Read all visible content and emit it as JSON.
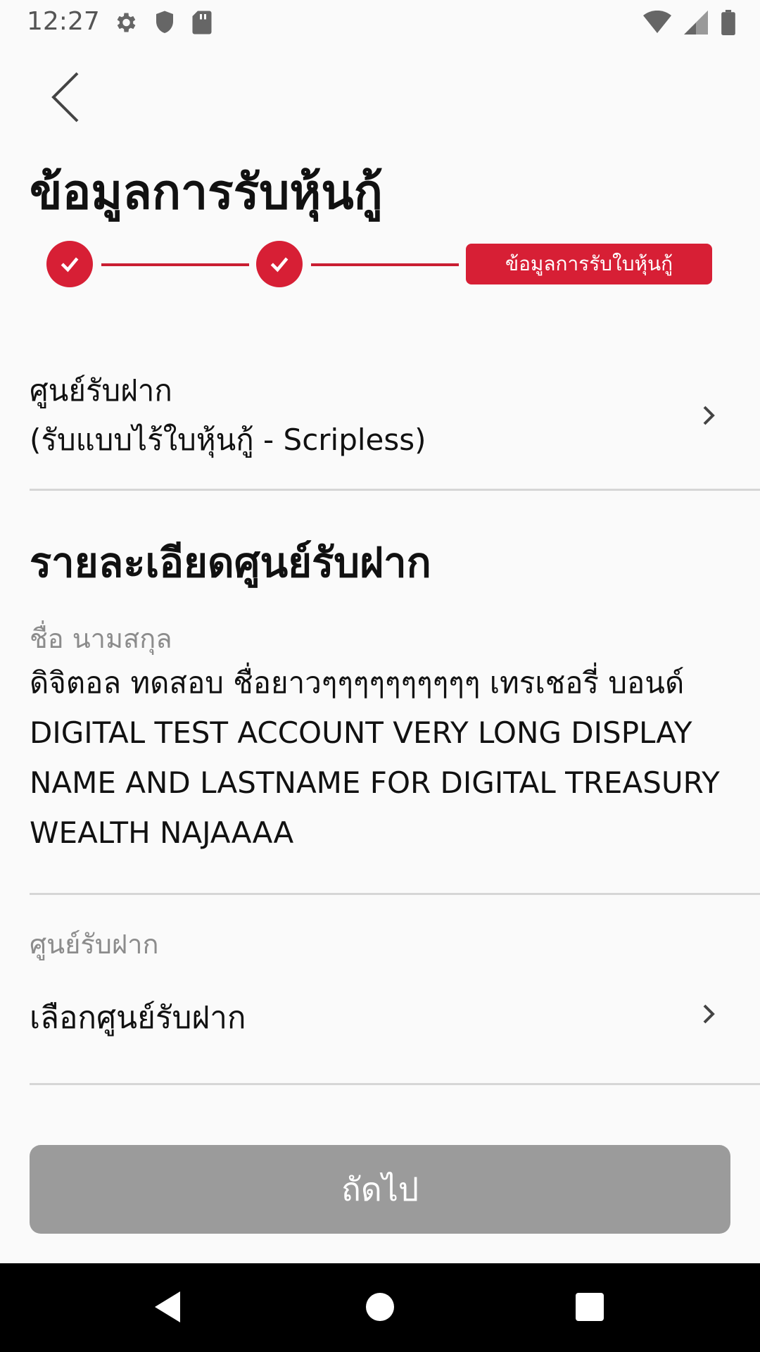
{
  "status_bar": {
    "time": "12:27",
    "icons_left": [
      "gear-icon",
      "shield-icon",
      "sd-card-icon"
    ],
    "icons_right": [
      "wifi-icon",
      "signal-icon",
      "battery-icon"
    ]
  },
  "header": {
    "title": "ข้อมูลการรับหุ้นกู้"
  },
  "stepper": {
    "steps_completed": 2,
    "current_step_label": "ข้อมูลการรับใบหุ้นกู้",
    "accent_color": "#d71f35"
  },
  "scripless_option": {
    "line1": "ศูนย์รับฝาก",
    "line2": "(รับแบบไร้ใบหุ้นกู้ - Scripless)"
  },
  "details": {
    "section_title": "รายละเอียดศูนย์รับฝาก",
    "name_label": "ชื่อ นามสกุล",
    "name_value": "ดิจิตอล ทดสอบ ชื่อยาวๆๆๆๆๆๆๆๆๆๆ เทรเชอรี่ บอนด์ DIGITAL TEST ACCOUNT VERY LONG DISPLAY NAME AND LASTNAME FOR DIGITAL TREASURY WEALTH NAJAAAA",
    "depository_label": "ศูนย์รับฝาก",
    "depository_placeholder": "เลือกศูนย์รับฝาก"
  },
  "actions": {
    "next_label": "ถัดไป",
    "next_enabled": false
  },
  "nav_bar": {
    "icons": [
      "back-nav-icon",
      "home-nav-icon",
      "recents-nav-icon"
    ]
  }
}
